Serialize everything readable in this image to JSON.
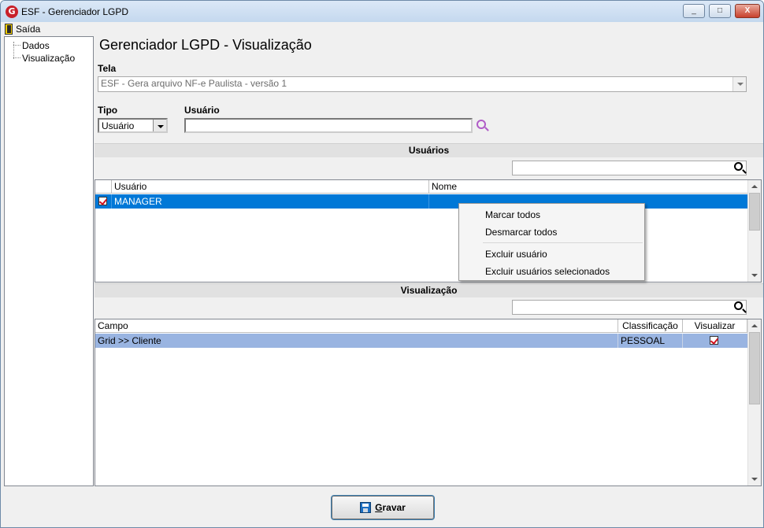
{
  "window": {
    "title": "ESF - Gerenciador LGPD",
    "icon_letter": "G",
    "controls": {
      "minimize": "_",
      "maximize": "□",
      "close": "X"
    }
  },
  "menu": {
    "exit_label": "Saída"
  },
  "tree": {
    "items": [
      "Dados",
      "Visualização"
    ]
  },
  "page_title": "Gerenciador LGPD - Visualização",
  "tela": {
    "label": "Tela",
    "value": "ESF - Gera arquivo NF-e Paulista - versão 1"
  },
  "tipo": {
    "label": "Tipo",
    "value": "Usuário"
  },
  "usuario": {
    "label": "Usuário",
    "value": ""
  },
  "usuarios_section": {
    "title": "Usuários",
    "search_value": "",
    "columns": [
      "Usuário",
      "Nome"
    ],
    "rows": [
      {
        "checked": true,
        "usuario": "MANAGER",
        "nome": ""
      }
    ]
  },
  "context_menu": {
    "items": [
      "Marcar todos",
      "Desmarcar todos",
      "Excluir usuário",
      "Excluir usuários selecionados"
    ]
  },
  "visualizacao_section": {
    "title": "Visualização",
    "search_value": "",
    "columns": [
      "Campo",
      "Classificação",
      "Visualizar"
    ],
    "rows": [
      {
        "campo": "Grid >> Cliente",
        "classificacao": "PESSOAL",
        "visualizar": true
      }
    ]
  },
  "save_button": {
    "accel": "G",
    "rest": "ravar"
  },
  "colors": {
    "selection": "#0078d7",
    "selection_inactive": "#99b4e1",
    "check_mark": "#d0101e",
    "search_icon_user": "#b05cc7"
  }
}
